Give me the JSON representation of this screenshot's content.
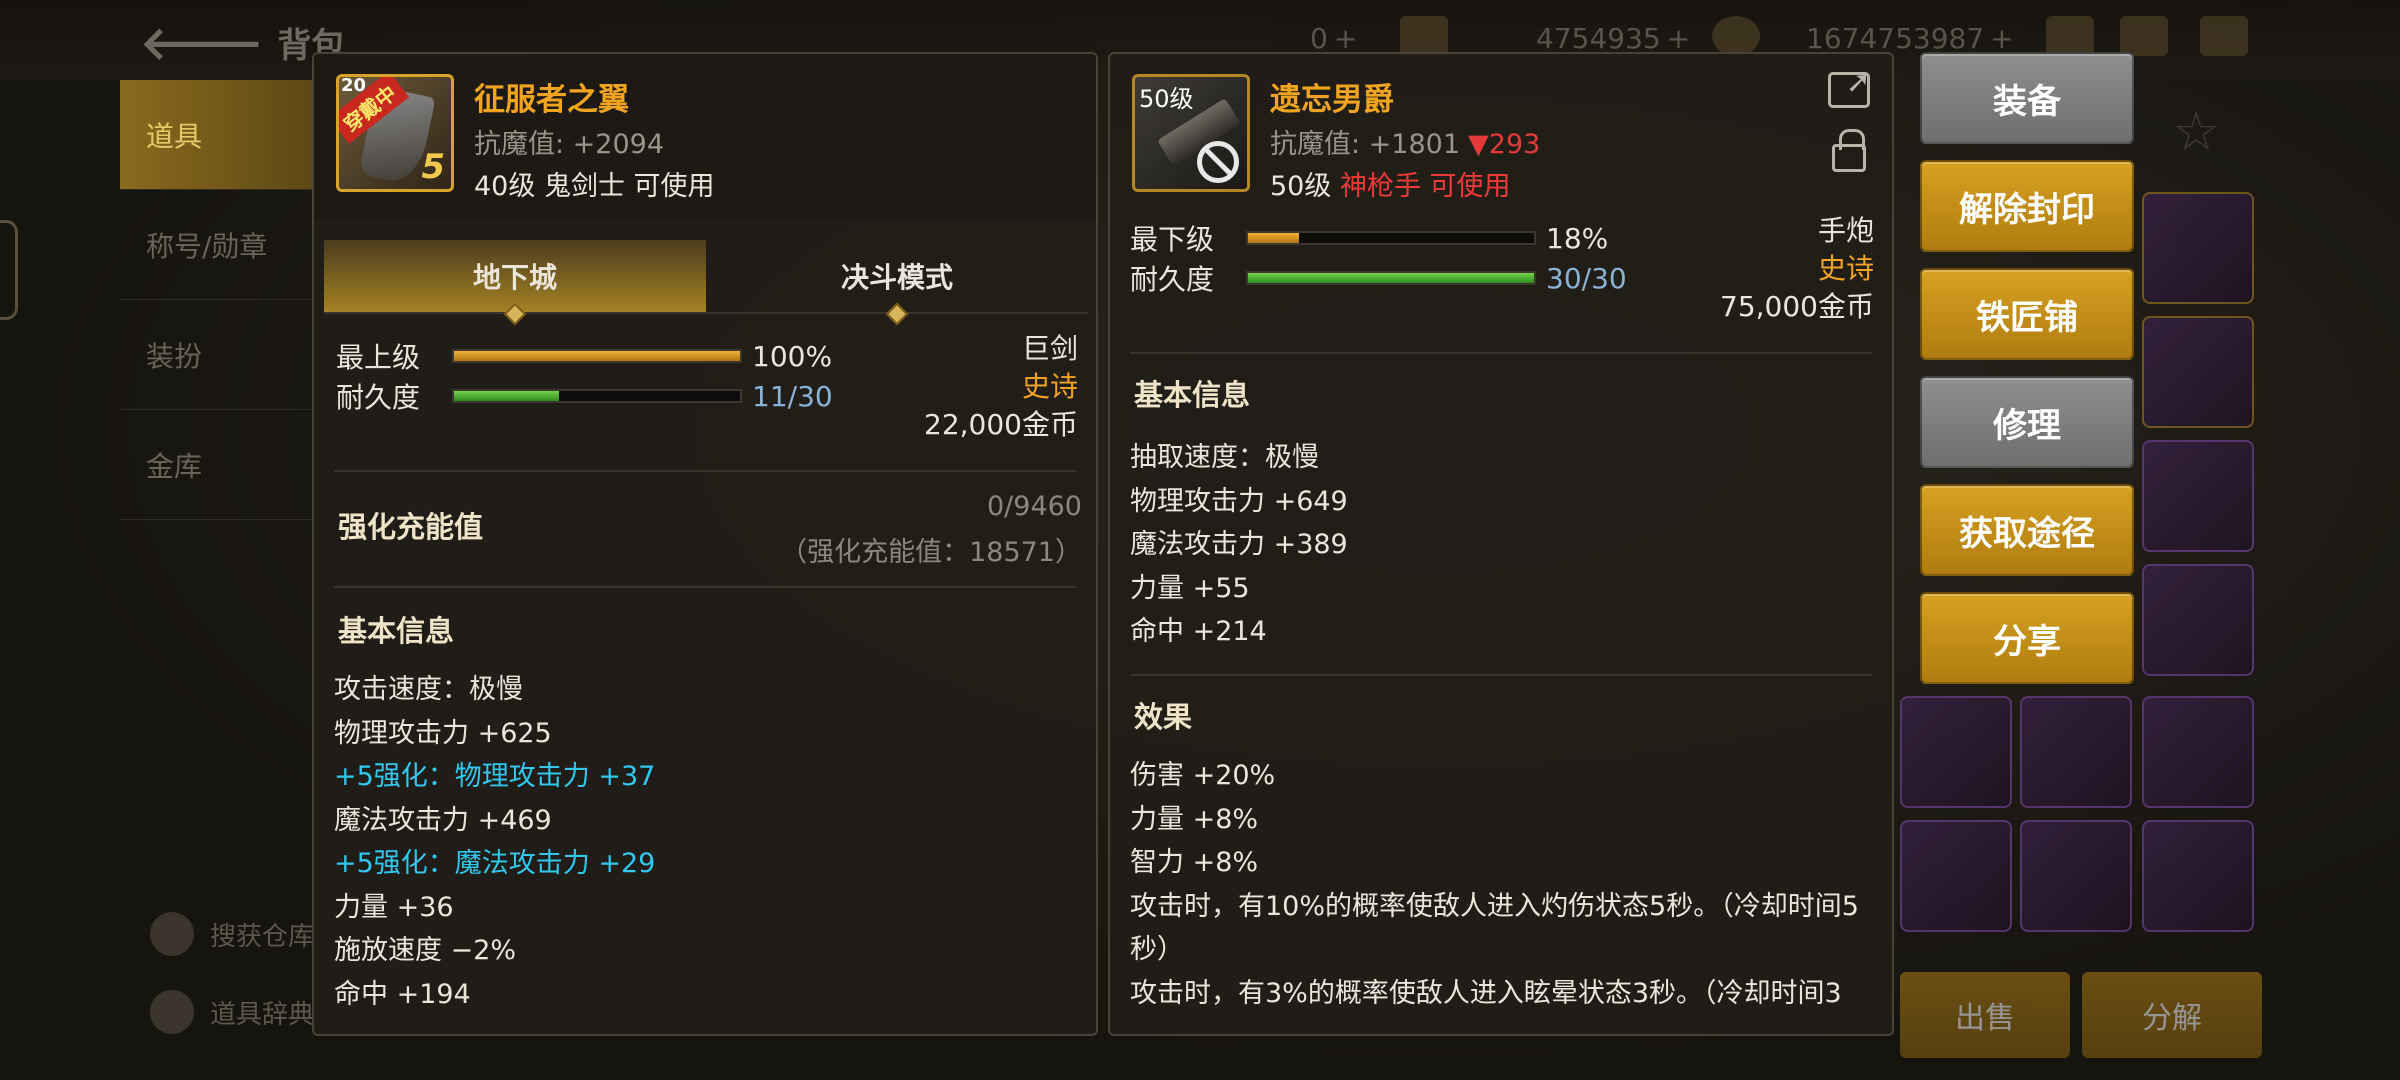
{
  "background": {
    "title": "背包",
    "nav": [
      "道具",
      "称号/勋章",
      "装扮",
      "金库"
    ],
    "bottom_links": [
      "搜获仓库",
      "道具辞典"
    ],
    "top_stats": [
      "0",
      "4754935",
      "1674753987"
    ],
    "bottom_buttons": [
      "出售",
      "分解"
    ]
  },
  "left_item": {
    "icon_level": "20",
    "icon_badge": "穿戴中",
    "icon_upgrade": "5",
    "name": "征服者之翼",
    "anti_magic": "抗魔值: +2094",
    "requirement": "40级 鬼剑士 可使用",
    "tabs": [
      "地下城",
      "决斗模式"
    ],
    "grade_label": "最上级",
    "grade_value": "100%",
    "grade_fraction": 1.0,
    "durability_label": "耐久度",
    "durability_value": "11/30",
    "durability_fraction": 0.3667,
    "type": "巨剑",
    "rarity": "史诗",
    "price": "22,000金币",
    "charge_title": "强化充能值",
    "charge_value": "0/9460",
    "charge_note": "（强化充能值：18571）",
    "basic_title": "基本信息",
    "basic_lines": [
      {
        "text": "攻击速度：极慢",
        "color": "normal"
      },
      {
        "text": "物理攻击力 +625",
        "color": "normal"
      },
      {
        "text": "+5强化：物理攻击力 +37",
        "color": "cyan"
      },
      {
        "text": "魔法攻击力 +469",
        "color": "normal"
      },
      {
        "text": "+5强化：魔法攻击力 +29",
        "color": "cyan"
      },
      {
        "text": "力量 +36",
        "color": "normal"
      },
      {
        "text": "施放速度 −2%",
        "color": "normal"
      },
      {
        "text": "命中 +194",
        "color": "normal"
      }
    ]
  },
  "right_item": {
    "icon_level": "50级",
    "name": "遗忘男爵",
    "anti_magic": "抗魔值: +1801",
    "anti_magic_delta": "▼293",
    "req_level": "50级",
    "req_class": "神枪手 可使用",
    "grade_label": "最下级",
    "grade_value": "18%",
    "grade_fraction": 0.18,
    "durability_label": "耐久度",
    "durability_value": "30/30",
    "durability_fraction": 1.0,
    "type": "手炮",
    "rarity": "史诗",
    "price": "75,000金币",
    "basic_title": "基本信息",
    "basic_lines": [
      "抽取速度：极慢",
      "物理攻击力 +649",
      "魔法攻击力 +389",
      "力量 +55",
      "命中 +214"
    ],
    "effect_title": "效果",
    "effect_lines": [
      "伤害 +20%",
      "力量 +8%",
      "智力 +8%",
      "攻击时，有10%的概率使敌人进入灼伤状态5秒。（冷却时间5秒）",
      "攻击时，有3%的概率使敌人进入眩晕状态3秒。（冷却时间3"
    ]
  },
  "actions": [
    {
      "label": "装备",
      "style": "grey"
    },
    {
      "label": "解除封印",
      "style": "gold"
    },
    {
      "label": "铁匠铺",
      "style": "gold"
    },
    {
      "label": "修理",
      "style": "grey"
    },
    {
      "label": "获取途径",
      "style": "gold"
    },
    {
      "label": "分享",
      "style": "gold"
    }
  ],
  "colors": {
    "accent_gold": "#f0a41f",
    "cyan": "#31c8f0",
    "red": "#f03a3a",
    "durability_blue": "#8ab2d6"
  }
}
